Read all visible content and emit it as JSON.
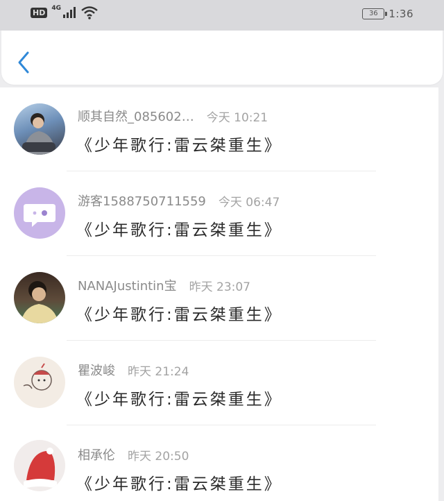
{
  "status_bar": {
    "hd": "HD",
    "network": "4G",
    "battery": "36",
    "time": "1:36"
  },
  "nav": {
    "back_icon": "chevron-left-icon",
    "accent": "#2f88d8"
  },
  "messages": [
    {
      "username": "顺其自然_085602…",
      "time": "今天 10:21",
      "text": "《少年歌行:雷云桀重生》"
    },
    {
      "username": "游客1588750711559",
      "time": "今天 06:47",
      "text": "《少年歌行:雷云桀重生》"
    },
    {
      "username": "NANAJustintin宝",
      "time": "昨天 23:07",
      "text": "《少年歌行:雷云桀重生》"
    },
    {
      "username": "瞿波峻",
      "time": "昨天 21:24",
      "text": "《少年歌行:雷云桀重生》"
    },
    {
      "username": "相承伦",
      "time": "昨天 20:50",
      "text": "《少年歌行:雷云桀重生》"
    }
  ]
}
